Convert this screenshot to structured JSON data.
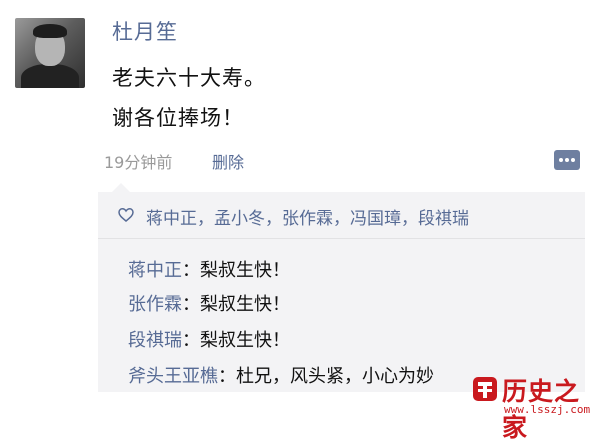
{
  "post": {
    "author": "杜月笙",
    "lines": [
      "老夫六十大寿。",
      "谢各位捧场！"
    ],
    "timestamp": "19分钟前",
    "delete_label": "删除",
    "comment_icon": "comment-icon"
  },
  "likes": {
    "icon": "heart-icon",
    "names": "蒋中正，孟小冬，张作霖，冯国璋，段祺瑞"
  },
  "comments": [
    {
      "author": "蒋中正",
      "sep": "：",
      "text": "梨叔生快！"
    },
    {
      "author": "张作霖",
      "sep": "：",
      "text": "梨叔生快！"
    },
    {
      "author": "段祺瑞",
      "sep": "：",
      "text": "梨叔生快！"
    },
    {
      "author": "斧头王亚樵",
      "sep": "：",
      "text": "杜兄，风头紧，小心为妙"
    }
  ],
  "watermark": {
    "title": "历史之家",
    "url": "www.lsszj.com",
    "color": "#c9191e"
  },
  "colors": {
    "link": "#576b95",
    "meta": "#9a9a9a",
    "panel": "#f3f3f5"
  }
}
